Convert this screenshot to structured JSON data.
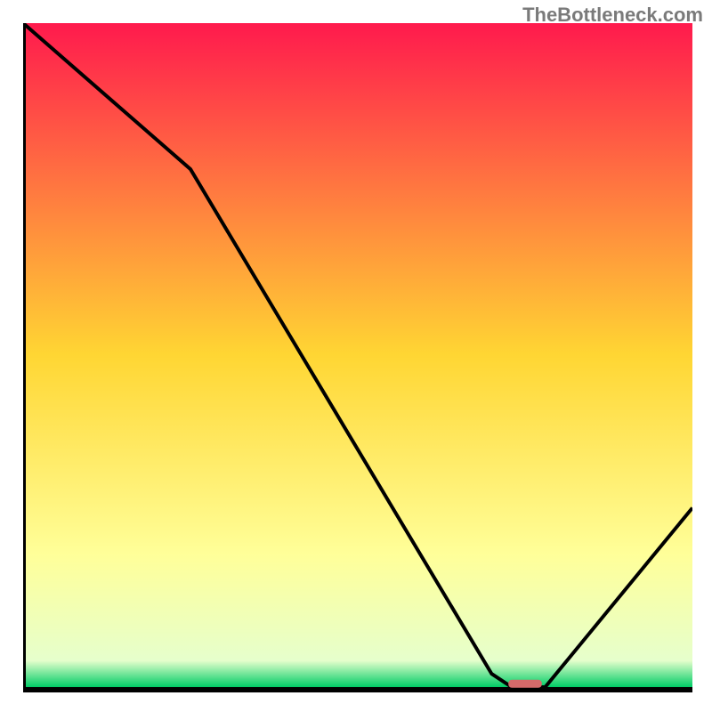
{
  "watermark": "TheBottleneck.com",
  "chart_data": {
    "type": "line",
    "title": "",
    "xlabel": "",
    "ylabel": "",
    "x": [
      0,
      25,
      70,
      73,
      78,
      100
    ],
    "values": [
      100,
      78,
      2,
      0,
      0,
      27
    ],
    "ylim": [
      0,
      100
    ],
    "xlim": [
      0,
      100
    ],
    "gradient_stops": [
      {
        "offset": 0,
        "color": "#ff1a4d"
      },
      {
        "offset": 50,
        "color": "#ffd633"
      },
      {
        "offset": 80,
        "color": "#ffff99"
      },
      {
        "offset": 96,
        "color": "#e6ffcc"
      },
      {
        "offset": 100,
        "color": "#00cc66"
      }
    ],
    "marker": {
      "x": 75,
      "y": 0.5,
      "width": 5,
      "height": 1.2,
      "color": "#d46a6a"
    },
    "axis_color": "#000000",
    "line_color": "#000000"
  }
}
